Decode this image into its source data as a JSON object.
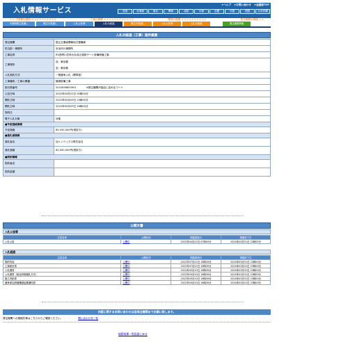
{
  "header": {
    "logo": "入札情報サービス",
    "links": [
      "★ヘルプ",
      "★お問い合わせ",
      "★全国版TOP"
    ],
    "regions": [
      "全国",
      "北海道",
      "東北",
      "関東",
      "北陸",
      "中部",
      "近畿",
      "中国",
      "四国",
      "九州沖縄"
    ],
    "colors": {
      "header_bg": "#1f63a8",
      "tab_dark": "#1c3a6b",
      "section": "#4f86c6",
      "label_bg": "#d6e3f3"
    }
  },
  "categories": [
    "＊＊ 中長期の建設 ＊＊＊＊＊＊＊＊＊＊",
    "工事の概要 ＊＊＊＊＊＊＊＊＊＊＊＊",
    "業務の概要 ＊＊＊＊＊＊＊＊＊＊",
    "発注機関の情報 ＊＊"
  ],
  "tabs": [
    {
      "label": "中長期発注見通し",
      "color": "blue"
    },
    {
      "label": "発注の見通し",
      "color": "blue"
    },
    {
      "label": "入札公告等",
      "color": "blue"
    },
    {
      "label": "入札の経過",
      "color": "dark"
    },
    {
      "label": "発注の見通し",
      "color": "orange"
    },
    {
      "label": "入札公告等",
      "color": "orange"
    },
    {
      "label": "入札の経過",
      "color": "orange"
    },
    {
      "label": "発注機関情報",
      "color": "green"
    }
  ],
  "detail": {
    "title": "入札の経過（工事）案件概要",
    "rows": [
      {
        "label": "発注機関",
        "value": "国土交通省関東地方整備局"
      },
      {
        "label": "担当部・事務所",
        "value": "京浜河川事務所"
      },
      {
        "label": "工事名称",
        "value": "R4多摩川右岸大丸床止施設ゲート設備修繕工事"
      },
      {
        "label": "工事場所",
        "value": "自：東京都",
        "value2": "至：東京都"
      },
      {
        "label": "入札契約方式",
        "value": "一般競争入札（標準型）"
      },
      {
        "label": "工事種別／工事の業種",
        "value": "機械設備工事"
      },
      {
        "label": "設計書番号",
        "value": "2022836650901",
        "note": "※発注機関が独自に定めるコード"
      },
      {
        "label": "公告日時",
        "value": "2022年04月22日 00時00分"
      },
      {
        "label": "開札日時",
        "value": "2022年05月09日 15時00分"
      },
      {
        "label": "開札日時",
        "value": "2022年05月09日 16時00分"
      },
      {
        "label": "契約日",
        "value": ""
      },
      {
        "label": "電子入札対象",
        "value": "対象"
      }
    ],
    "group_estimated": "■予定価格情報",
    "estimated_label": "予定価格",
    "estimated_value": "89,030,000円(税抜き)",
    "group_winner": "■落札者情報",
    "winner_label": "落札者名",
    "winner_value": "加イノベックス株式会社",
    "winner_price_label": "落札価格",
    "winner_price_value": "83,000,000円(税抜き)",
    "group_contract": "■契約情報",
    "contract_name_label": "契約者名",
    "contract_amount_label": "契約金額",
    "contract_name_value": "",
    "contract_amount_value": ""
  },
  "public_docs": {
    "title": "公開文書",
    "announce_title": "入札公告等",
    "headers": [
      "文書名称",
      "公開状況",
      "掲載更新日",
      "掲載終了日"
    ],
    "announce_rows": [
      [
        "入札公告",
        "公開中",
        "2022年04月22日 07時00分",
        "2024年03月31日 23時00分"
      ]
    ],
    "progress_title": "入札経過",
    "progress_rows": [
      [
        "契約内容",
        "公開中",
        "2022年07月22日 18時39分",
        "2024年03月31日 23時00分"
      ],
      [
        "工事設計書",
        "公開中",
        "2022年07月22日 18時39分",
        "2024年03月31日 23時00分"
      ],
      [
        "入札調書",
        "公開中",
        "2022年05月10日 18時39分",
        "2024年03月31日 23時00分"
      ],
      [
        "入札調書（総合評価落札方式）",
        "公開中",
        "2022年05月10日 18時39分",
        "2024年03月31日 23時00分"
      ],
      [
        "施工内訳書",
        "公開中",
        "2022年05月10日 18時39分",
        "2024年03月31日 23時00分"
      ],
      [
        "競争参加資格確認結果通知書",
        "公開中",
        "2022年05月10日 18時39分",
        "2024年03月31日 23時00分"
      ]
    ]
  },
  "contact": {
    "bar": "内容に関するお問い合わせは各発注機関までお願い致します。",
    "text": "発注機関への連絡先等はこちらからご確認ください。",
    "link": "問い合わせ先一覧"
  },
  "back_link": "検索結果一覧画面に戻る"
}
